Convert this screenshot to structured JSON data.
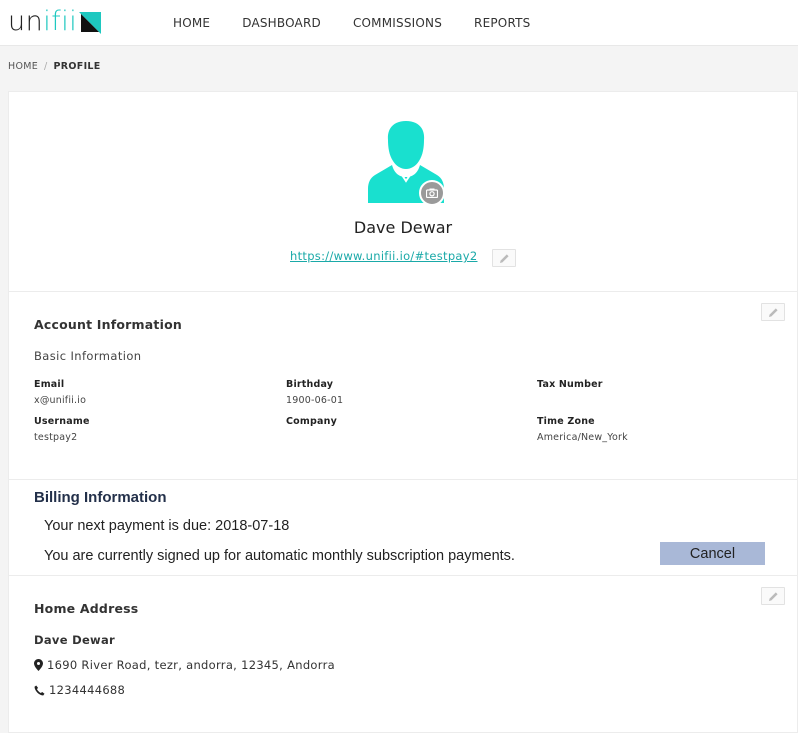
{
  "app": {
    "logo_text_dark": "un",
    "logo_text_accent": "ifii",
    "brand_accent": "#1ec8c0"
  },
  "nav": {
    "items": [
      {
        "label": "HOME"
      },
      {
        "label": "DASHBOARD"
      },
      {
        "label": "COMMISSIONS"
      },
      {
        "label": "REPORTS"
      }
    ]
  },
  "breadcrumb": {
    "home": "HOME",
    "separator": "/",
    "current": "PROFILE"
  },
  "profile": {
    "name": "Dave Dewar",
    "url": "https://www.unifii.io/#testpay2",
    "avatar_icon": "user-avatar-icon",
    "avatar_color": "#19e0cf",
    "camera_icon": "camera-icon"
  },
  "account": {
    "title": "Account Information",
    "subtitle": "Basic Information",
    "fields": {
      "email_label": "Email",
      "email_value": "x@unifii.io",
      "birthday_label": "Birthday",
      "birthday_value": "1900-06-01",
      "tax_label": "Tax Number",
      "tax_value": "",
      "username_label": "Username",
      "username_value": "testpay2",
      "company_label": "Company",
      "company_value": "",
      "timezone_label": "Time Zone",
      "timezone_value": "America/New_York"
    }
  },
  "billing": {
    "title": "Billing Information",
    "next_payment": "Your next payment is due: 2018-07-18",
    "subscription_note": "You are currently signed up for automatic monthly subscription payments.",
    "cancel_label": "Cancel",
    "cancel_color": "#a9b8d7"
  },
  "address": {
    "title": "Home Address",
    "name": "Dave Dewar",
    "street": "1690 River Road, tezr, andorra, 12345, Andorra",
    "phone": "1234444688",
    "location_icon": "map-marker-icon",
    "phone_icon": "phone-icon"
  }
}
